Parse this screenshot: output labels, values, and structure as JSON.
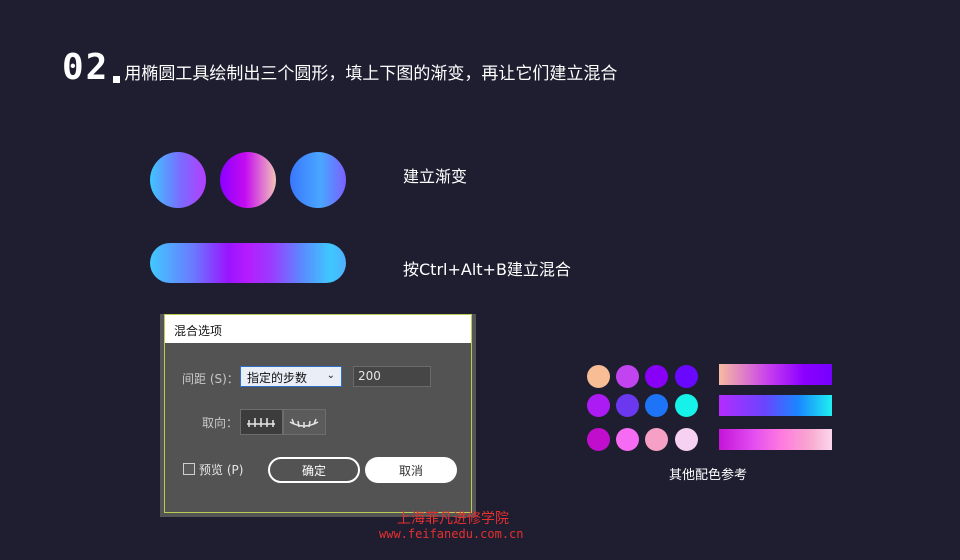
{
  "title": {
    "number": "02",
    "text": "用椭圆工具绘制出三个圆形，填上下图的渐变，再让它们建立混合"
  },
  "labels": {
    "gradient": "建立渐变",
    "blend": "按Ctrl+Alt+B建立混合"
  },
  "dialog": {
    "title": "混合选项",
    "spacing_label": "间距 (S)：",
    "spacing_selected": "指定的步数",
    "steps_value": "200",
    "orientation_label": "取向：",
    "preview_label": "预览 (P)",
    "ok_label": "确定",
    "cancel_label": "取消"
  },
  "palette": {
    "label": "其他配色参考",
    "dots": [
      "#f8bd95",
      "#c243f0",
      "#8800f6",
      "#6a08ff",
      "#ad1bf4",
      "#6b38f0",
      "#1d74f6",
      "#16f1e9",
      "#c10ecc",
      "#f66bf4",
      "#f6a0c6",
      "#f6d1f2"
    ]
  },
  "watermark": {
    "cn": "上海菲凡进修学院",
    "url": "www.feifanedu.com.cn"
  }
}
